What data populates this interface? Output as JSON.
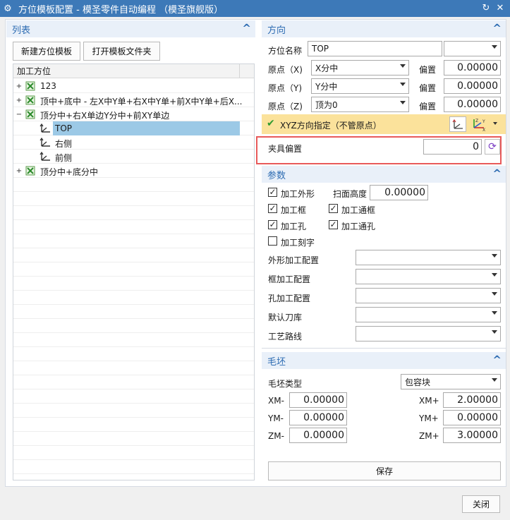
{
  "window": {
    "title": "方位模板配置 - 模圣零件自动编程 （模圣旗舰版）"
  },
  "list_section": {
    "title": "列表",
    "new_button": "新建方位模板",
    "open_folder_button": "打开模板文件夹",
    "tree_header": "加工方位",
    "tree_items": [
      {
        "label": "123"
      },
      {
        "label": "顶中+底中 - 左X中Y单+右X中Y单+前X中Y单+后X..."
      },
      {
        "label": "顶分中+右X单边Y分中+前XY单边"
      },
      {
        "label": "TOP"
      },
      {
        "label": "右侧"
      },
      {
        "label": "前侧"
      },
      {
        "label": "顶分中+底分中"
      }
    ]
  },
  "direction_section": {
    "title": "方向",
    "name_label": "方位名称",
    "name_value": "TOP",
    "origin_x_label": "原点（X)",
    "origin_x_value": "X分中",
    "origin_y_label": "原点（Y)",
    "origin_y_value": "Y分中",
    "origin_z_label": "原点（Z)",
    "origin_z_value": "顶为0",
    "offset_label": "偏置",
    "offset_x": "0.00000",
    "offset_y": "0.00000",
    "offset_z": "0.00000",
    "xyz_label": "XYZ方向指定（不管原点）",
    "fixture_label": "夹具偏置",
    "fixture_value": "0"
  },
  "params_section": {
    "title": "参数",
    "cb_outline": "加工外形",
    "scan_height_label": "扫面高度",
    "scan_height_value": "0.00000",
    "cb_frame": "加工框",
    "cb_through_frame": "加工通框",
    "cb_hole": "加工孔",
    "cb_through_hole": "加工通孔",
    "cb_engrave": "加工刻字",
    "outline_config_label": "外形加工配置",
    "frame_config_label": "框加工配置",
    "hole_config_label": "孔加工配置",
    "tool_lib_label": "默认刀库",
    "route_label": "工艺路线"
  },
  "blank_section": {
    "title": "毛坯",
    "type_label": "毛坯类型",
    "type_value": "包容块",
    "xm_label": "XM-",
    "xm_value": "0.00000",
    "xp_label": "XM+",
    "xp_value": "2.00000",
    "ym_label": "YM-",
    "ym_value": "0.00000",
    "yp_label": "YM+",
    "yp_value": "0.00000",
    "zm_label": "ZM-",
    "zm_value": "0.00000",
    "zp_label": "ZM+",
    "zp_value": "3.00000",
    "save_button": "保存"
  },
  "footer": {
    "close_button": "关闭"
  },
  "colors": {
    "titlebar": "#3d79b8",
    "section_head": "#e9f0f9",
    "accent": "#2f6db3",
    "selection": "#9cc9e6",
    "xyz_bar": "#fbe29b",
    "highlight": "#e85a5a"
  }
}
